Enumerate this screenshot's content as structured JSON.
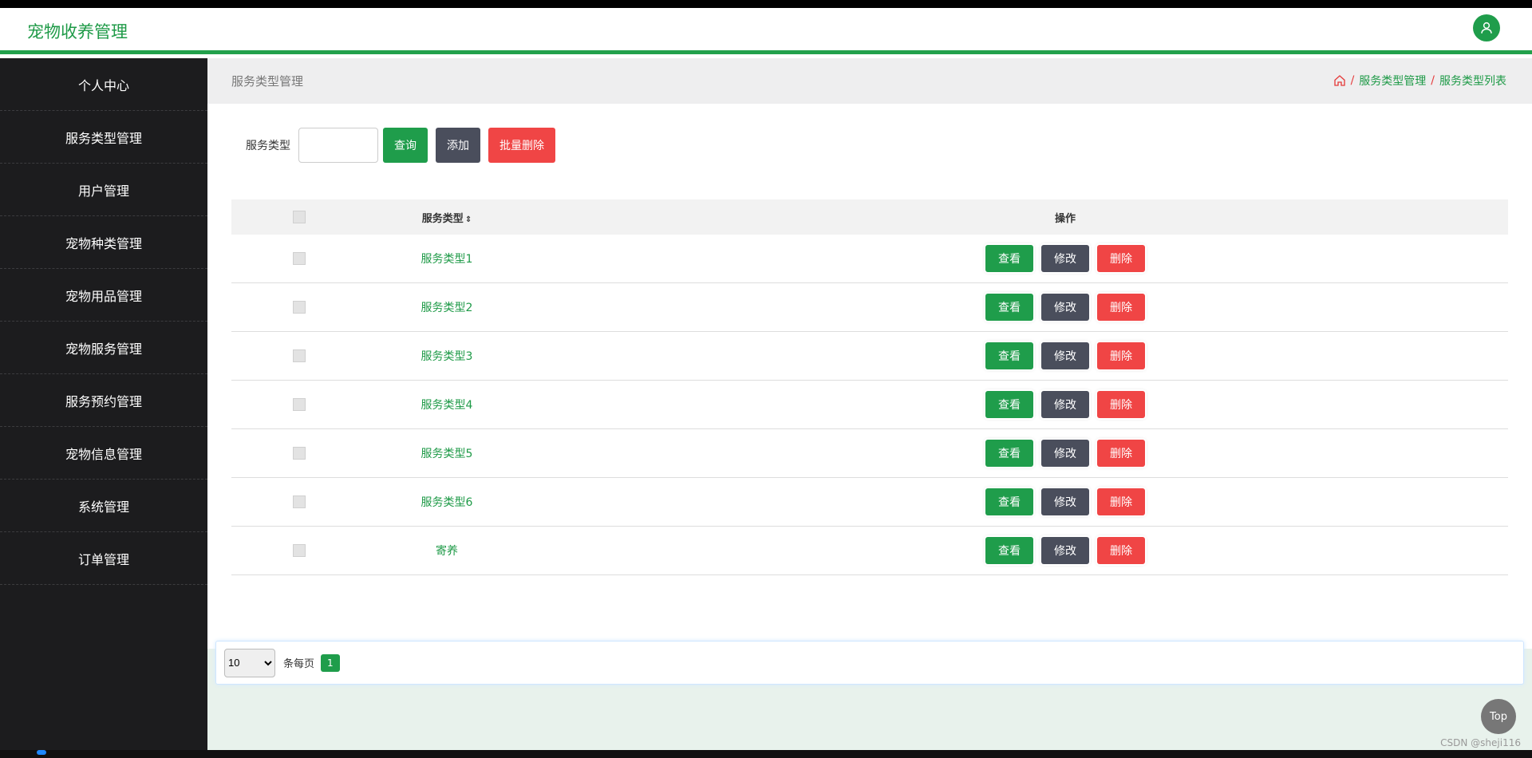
{
  "app": {
    "title": "宠物收养管理"
  },
  "sidebar": {
    "items": [
      {
        "label": "个人中心"
      },
      {
        "label": "服务类型管理"
      },
      {
        "label": "用户管理"
      },
      {
        "label": "宠物种类管理"
      },
      {
        "label": "宠物用品管理"
      },
      {
        "label": "宠物服务管理"
      },
      {
        "label": "服务预约管理"
      },
      {
        "label": "宠物信息管理"
      },
      {
        "label": "系统管理"
      },
      {
        "label": "订单管理"
      }
    ]
  },
  "page": {
    "title": "服务类型管理",
    "breadcrumb": {
      "sep": "/",
      "level1": "服务类型管理",
      "level2": "服务类型列表"
    }
  },
  "search": {
    "label": "服务类型",
    "value": "",
    "query_label": "查询",
    "add_label": "添加",
    "batch_delete_label": "批量删除"
  },
  "table": {
    "headers": {
      "name": "服务类型",
      "sort_icon": "⇕",
      "ops": "操作"
    },
    "rows": [
      {
        "name": "服务类型1"
      },
      {
        "name": "服务类型2"
      },
      {
        "name": "服务类型3"
      },
      {
        "name": "服务类型4"
      },
      {
        "name": "服务类型5"
      },
      {
        "name": "服务类型6"
      },
      {
        "name": "寄养"
      }
    ],
    "actions": {
      "view": "查看",
      "edit": "修改",
      "delete": "删除"
    }
  },
  "pager": {
    "page_size": "10",
    "per_page_label": "条每页",
    "current_page": "1"
  },
  "top_button": "Top",
  "watermark": "CSDN @sheji116",
  "colors": {
    "brand": "#1f9d4b",
    "danger": "#f04545",
    "dark": "#4a4e5c",
    "sidebar": "#1c1c1e"
  }
}
